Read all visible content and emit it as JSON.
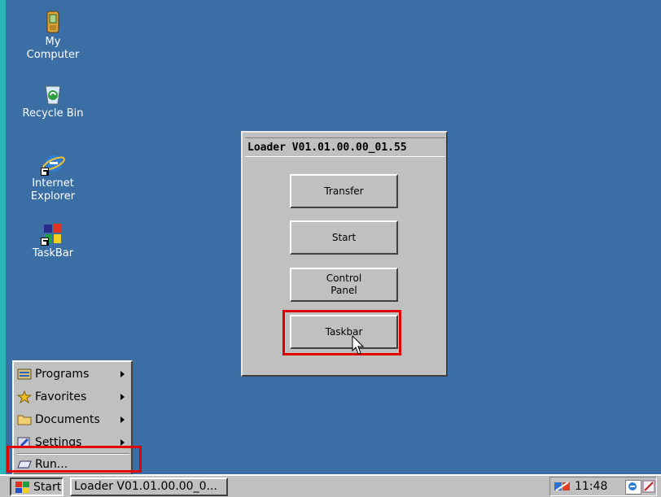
{
  "desktop": {
    "icons": [
      {
        "label": "My\nComputer",
        "icon": "my-computer-icon"
      },
      {
        "label": "Recycle Bin",
        "icon": "recycle-bin-icon"
      },
      {
        "label": "Internet\nExplorer",
        "icon": "internet-explorer-icon"
      },
      {
        "label": "TaskBar",
        "icon": "taskbar-icon"
      }
    ]
  },
  "loader": {
    "title": "Loader V01.01.00.00_01.55",
    "buttons": {
      "transfer": "Transfer",
      "start": "Start",
      "control_panel": "Control\nPanel",
      "taskbar": "Taskbar"
    }
  },
  "start_menu": {
    "items": [
      {
        "label": "Programs",
        "icon": "programs-icon",
        "submenu": true
      },
      {
        "label": "Favorites",
        "icon": "favorites-star-icon",
        "submenu": true
      },
      {
        "label": "Documents",
        "icon": "documents-folder-icon",
        "submenu": true
      },
      {
        "label": "Settings",
        "icon": "settings-icon",
        "submenu": true
      },
      {
        "label": "Run...",
        "icon": "run-icon",
        "submenu": false
      }
    ]
  },
  "taskbar": {
    "start_label": "Start",
    "task_label": "Loader V01.01.00.00_0...",
    "clock": "11:48"
  },
  "colors": {
    "desktop": "#3a6ea5",
    "highlight": "#e00000",
    "chrome": "#c0c0c0"
  }
}
